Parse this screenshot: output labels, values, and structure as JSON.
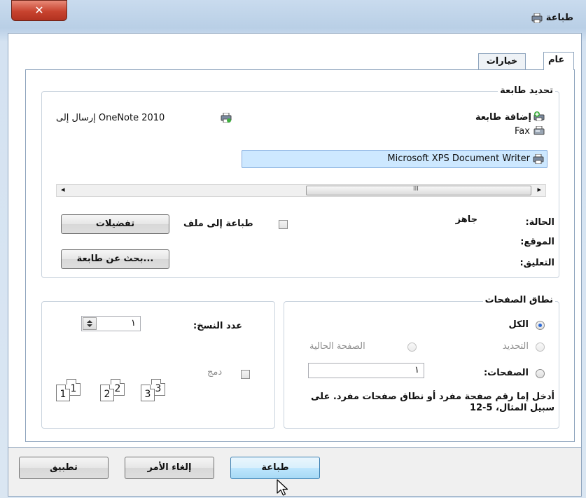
{
  "window": {
    "title": "طباعة",
    "close_glyph": "✕"
  },
  "tabs": [
    {
      "label": "عام"
    },
    {
      "label": "خيارات"
    }
  ],
  "select_printer": {
    "label": "تحديد طابعة",
    "items": [
      {
        "label": "إضافة طابعة",
        "icon": "add-printer-icon"
      },
      {
        "label": "Fax",
        "icon": "fax-icon"
      },
      {
        "label": "Microsoft XPS Document Writer",
        "icon": "printer-icon",
        "selected": true
      },
      {
        "label": "OneNote 2010 إرسال إلى",
        "icon": "printer-icon"
      }
    ],
    "scroll_grip": "III",
    "scroll_left": "◂",
    "scroll_right": "▸"
  },
  "status": {
    "status_label": "الحالة:",
    "status_value": "جاهز",
    "location_label": "الموقع:",
    "comment_label": "التعليق:",
    "print_to_file_label": "طباعة إلى ملف",
    "preferences_button": "تفضيلات",
    "find_printer_button": "بحث عن طابعة..."
  },
  "page_range": {
    "label": "نطاق الصفحات",
    "all": "الكل",
    "selection": "التحديد",
    "current_page": "الصفحة الحالية",
    "pages": "الصفحات:",
    "pages_value": "١",
    "hint": "أدخل إما رقم صفحة مفرد أو نطاق صفحات مفرد. على سبيل المثال، 5-12"
  },
  "copies": {
    "label": "عدد النسخ:",
    "value": "١",
    "collate": "دمج",
    "pages": [
      "1",
      "1",
      "2",
      "2",
      "3",
      "3"
    ]
  },
  "buttons": {
    "print": "طباعة",
    "cancel": "إلغاء الأمر",
    "apply": "تطبيق"
  },
  "colors": {
    "accent": "#2d6ad6",
    "selection": "#cde8ff",
    "frame": "#b9cfe6"
  }
}
